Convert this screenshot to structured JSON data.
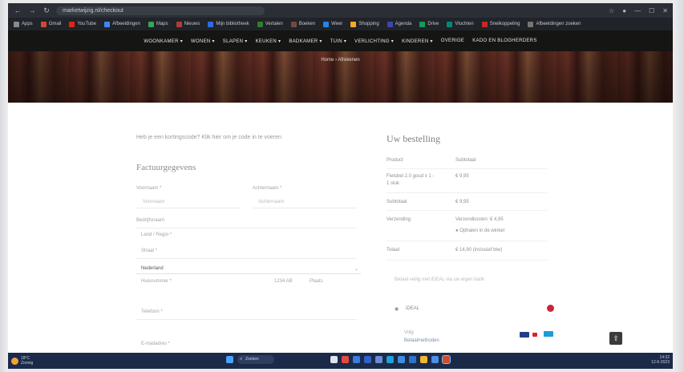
{
  "browser": {
    "url": "marketwijzig.nl/checkout",
    "bookmarks": [
      {
        "label": "Apps",
        "color": "#8a8a8a"
      },
      {
        "label": "Gmail",
        "color": "#d44638"
      },
      {
        "label": "YouTube",
        "color": "#e62117"
      },
      {
        "label": "Afbeeldingen",
        "color": "#4285f4"
      },
      {
        "label": "Maps",
        "color": "#34a853"
      },
      {
        "label": "Nieuws",
        "color": "#b33a3a"
      },
      {
        "label": "Mijn bibliotheek",
        "color": "#2d6cdf"
      },
      {
        "label": "Vertalen",
        "color": "#2e7d32"
      },
      {
        "label": "Boeken",
        "color": "#6d4c41"
      },
      {
        "label": "Weer",
        "color": "#1e88e5"
      },
      {
        "label": "Shopping",
        "color": "#f9a825"
      },
      {
        "label": "Agenda",
        "color": "#3949ab"
      },
      {
        "label": "Drive",
        "color": "#0f9d58"
      },
      {
        "label": "Vluchten",
        "color": "#00897b"
      },
      {
        "label": "Snelkoppeling",
        "color": "#c62828"
      },
      {
        "label": "Afbeeldingen zoeken",
        "color": "#757575"
      }
    ]
  },
  "site_nav": [
    "WOONKAMER ▾",
    "WONEN ▾",
    "SLAPEN ▾",
    "KEUKEN ▾",
    "BADKAMER ▾",
    "TUIN ▾",
    "VERLICHTING ▾",
    "KINDEREN ▾",
    "OVERIGE",
    "KADO EN BLOGHERDERS"
  ],
  "hero": {
    "breadcrumb": "Home › Afrekenen"
  },
  "checkout": {
    "coupon_text": "Heb je een kortingscode? Klik hier om je code in te voeren",
    "billing_title": "Factuurgegevens",
    "labels": {
      "first_name": "Voornaam *",
      "last_name": "Achternaam *",
      "company": "Bedrijfsnaam",
      "country": "Land / Regio *",
      "street": "Straat *",
      "house_no": "Huisnummer *",
      "postcode": "Postcode *",
      "city": "Plaats *",
      "phone": "Telefoon *",
      "email": "E-mailadres *"
    },
    "values": {
      "first_name": "Voornaam",
      "last_name": "Achternaam",
      "country": "Nederland",
      "street": "Straatnaam",
      "postcode": "1234 AB",
      "city": "Plaats"
    }
  },
  "order": {
    "title": "Uw bestelling",
    "rows": [
      {
        "k": "Product",
        "v": "Subtotaal"
      },
      {
        "k": "Fietsbel 2.0 goud x 1 - 1 stuk",
        "v": "€ 9,95"
      },
      {
        "k": "Subtotaal",
        "v": "€ 9,95"
      },
      {
        "k": "Verzending",
        "v": "Verzendkosten: € 4,95"
      },
      {
        "k": "",
        "v": "● Ophalen in de winkel"
      },
      {
        "k": "Totaal",
        "v": "€ 14,90 (inclusief btw)"
      }
    ],
    "payment_note": "Betaal veilig met iDEAL via uw eigen bank",
    "payment_option": "iDEAL",
    "footer_lines": [
      "Volg",
      "Betaalmethoden"
    ]
  },
  "taskbar": {
    "weather_temp": "18°C",
    "weather_desc": "Zonnig",
    "search_placeholder": "Zoeken",
    "time": "14:32",
    "date": "12-6-2023"
  },
  "colors": {
    "nav_bg": "#151514",
    "taskbar_bg": "#1c2a4a",
    "accent_red": "#c8263c"
  }
}
